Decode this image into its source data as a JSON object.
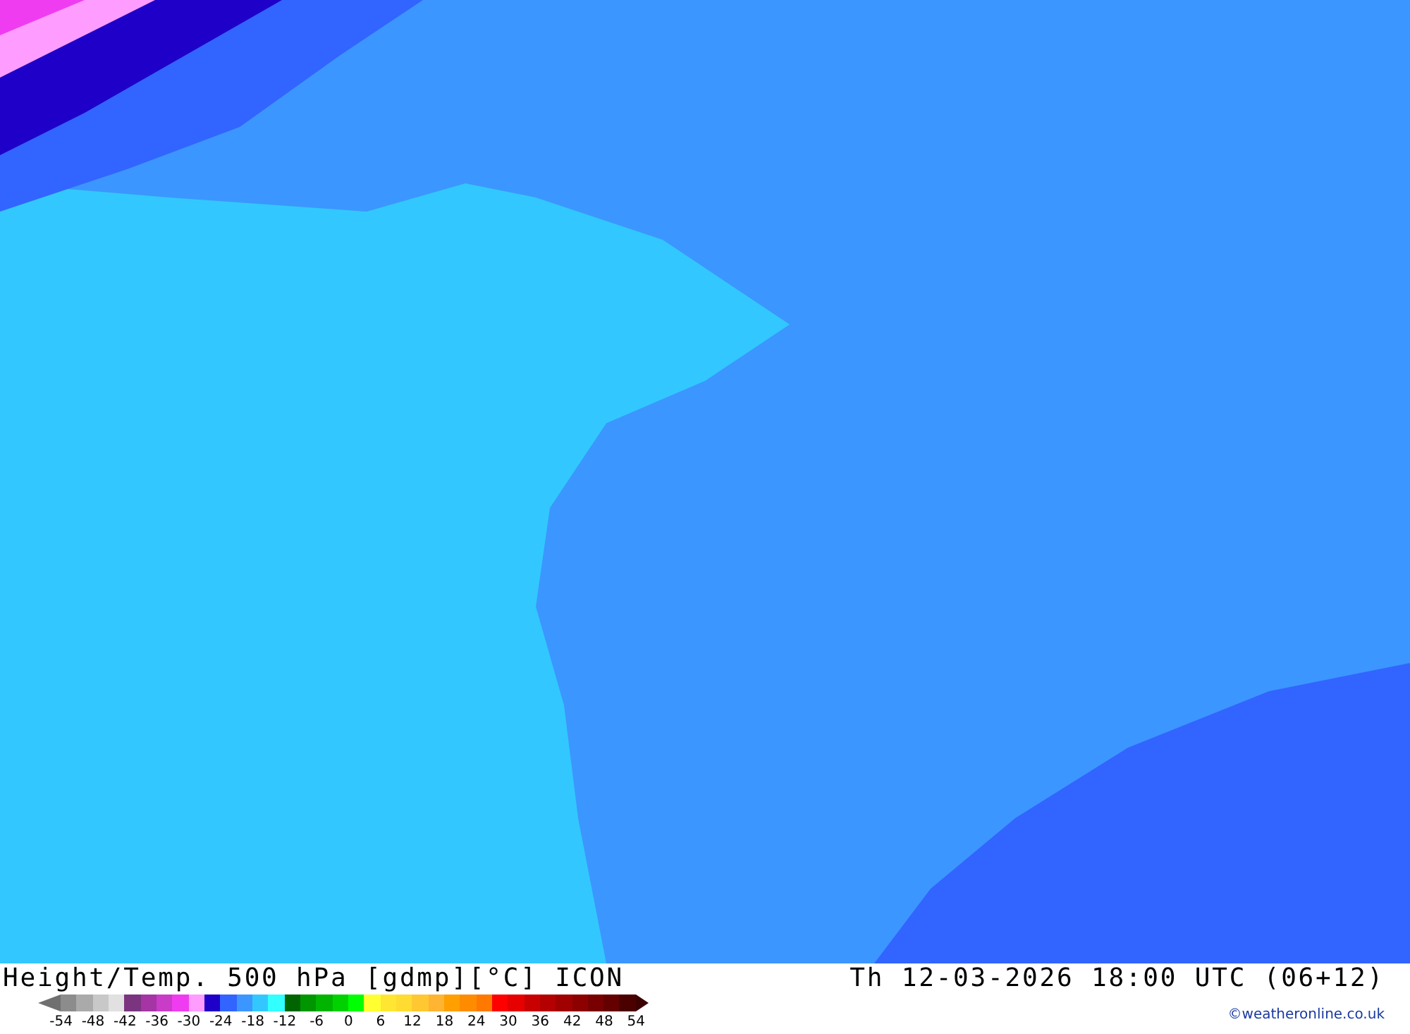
{
  "footer": {
    "title": "Height/Temp. 500 hPa [gdmp][°C] ICON",
    "datetime": "Th 12-03-2026 18:00 UTC (06+12)",
    "copyright": "©weatheronline.co.uk"
  },
  "legend": {
    "swatches": [
      {
        "color": "#8c8c8c"
      },
      {
        "color": "#aaaaaa"
      },
      {
        "color": "#c8c8c8"
      },
      {
        "color": "#e1e1e1"
      },
      {
        "color": "#7b3580"
      },
      {
        "color": "#a535a5"
      },
      {
        "color": "#c83cc8"
      },
      {
        "color": "#f03cf0"
      },
      {
        "color": "#ff9cff"
      },
      {
        "color": "#1e00c8"
      },
      {
        "color": "#3264ff"
      },
      {
        "color": "#3c96ff"
      },
      {
        "color": "#32c8ff"
      },
      {
        "color": "#32ffff"
      },
      {
        "color": "#006400"
      },
      {
        "color": "#009600"
      },
      {
        "color": "#00b400"
      },
      {
        "color": "#00d200"
      },
      {
        "color": "#00ff00"
      },
      {
        "color": "#ffff32"
      },
      {
        "color": "#ffe632"
      },
      {
        "color": "#ffdc32"
      },
      {
        "color": "#ffc832"
      },
      {
        "color": "#ffb432"
      },
      {
        "color": "#ffa000"
      },
      {
        "color": "#ff8c00"
      },
      {
        "color": "#ff7800"
      },
      {
        "color": "#ff0000"
      },
      {
        "color": "#e60000"
      },
      {
        "color": "#c80000"
      },
      {
        "color": "#b40000"
      },
      {
        "color": "#a00000"
      },
      {
        "color": "#8c0000"
      },
      {
        "color": "#780000"
      },
      {
        "color": "#640000"
      },
      {
        "color": "#4b0000"
      }
    ],
    "labels": [
      "-54",
      "-48",
      "-42",
      "-36",
      "-30",
      "-24",
      "-18",
      "-12",
      "-6",
      "0",
      "6",
      "12",
      "18",
      "24",
      "30",
      "36",
      "42",
      "48",
      "54"
    ]
  }
}
